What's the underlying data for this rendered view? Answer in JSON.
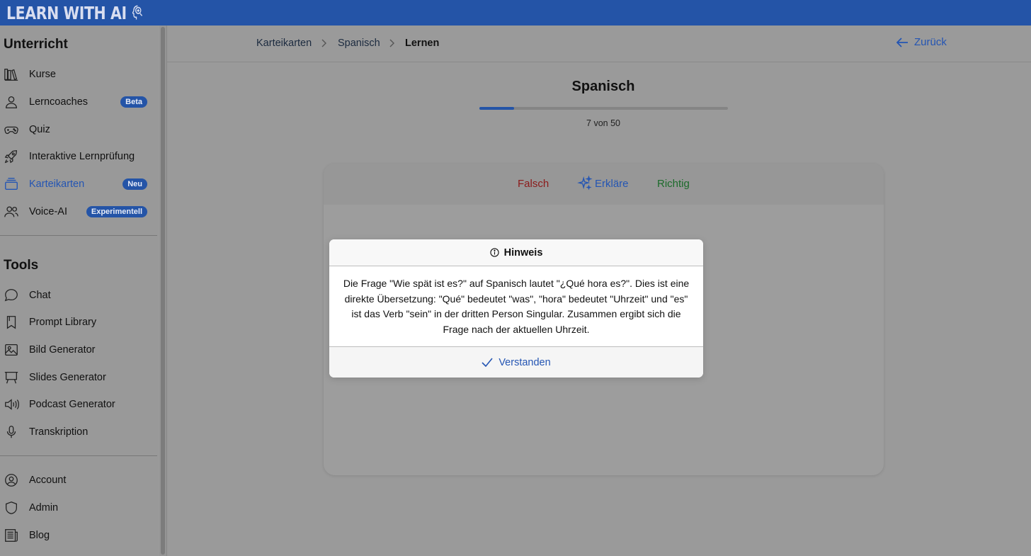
{
  "app": {
    "logo_text": "LEARN WITH AI",
    "brand_color": "#2454a7"
  },
  "sidebar": {
    "section_unterricht": "Unterricht",
    "section_tools": "Tools",
    "items": [
      {
        "label": "Kurse",
        "icon": "books-icon"
      },
      {
        "label": "Lerncoaches",
        "icon": "user-icon",
        "badge": "Beta"
      },
      {
        "label": "Quiz",
        "icon": "gamepad-icon"
      },
      {
        "label": "Interaktive Lernprüfung",
        "icon": "rocket-icon"
      },
      {
        "label": "Karteikarten",
        "icon": "cards-icon",
        "badge": "Neu",
        "active": true
      },
      {
        "label": "Voice-AI",
        "icon": "users-icon",
        "badge": "Experimentell"
      }
    ],
    "tools": [
      {
        "label": "Chat",
        "icon": "chat-icon"
      },
      {
        "label": "Prompt Library",
        "icon": "bookmark-icon"
      },
      {
        "label": "Bild Generator",
        "icon": "image-icon"
      },
      {
        "label": "Slides Generator",
        "icon": "presentation-icon"
      },
      {
        "label": "Podcast Generator",
        "icon": "speaker-icon"
      },
      {
        "label": "Transkription",
        "icon": "microphone-icon"
      }
    ],
    "account": [
      {
        "label": "Account",
        "icon": "account-icon"
      },
      {
        "label": "Admin",
        "icon": "shield-icon"
      },
      {
        "label": "Blog",
        "icon": "newspaper-icon"
      }
    ]
  },
  "breadcrumb": [
    "Karteikarten",
    "Spanisch",
    "Lernen"
  ],
  "back_label": "Zurück",
  "deck": {
    "title": "Spanisch",
    "progress_text": "7 von 50",
    "progress_fraction": 0.14
  },
  "card": {
    "falsch": "Falsch",
    "erklaere": "Erkläre",
    "richtig": "Richtig"
  },
  "modal": {
    "title": "Hinweis",
    "text": "Die Frage \"Wie spät ist es?\" auf Spanisch lautet \"¿Qué hora es?\". Dies ist eine direkte Übersetzung: \"Qué\" bedeutet \"was\", \"hora\" bedeutet \"Uhrzeit\" und \"es\" ist das Verb \"sein\" in der dritten Person Singular. Zusammen ergibt sich die Frage nach der aktuellen Uhrzeit.",
    "confirm": "Verstanden"
  }
}
